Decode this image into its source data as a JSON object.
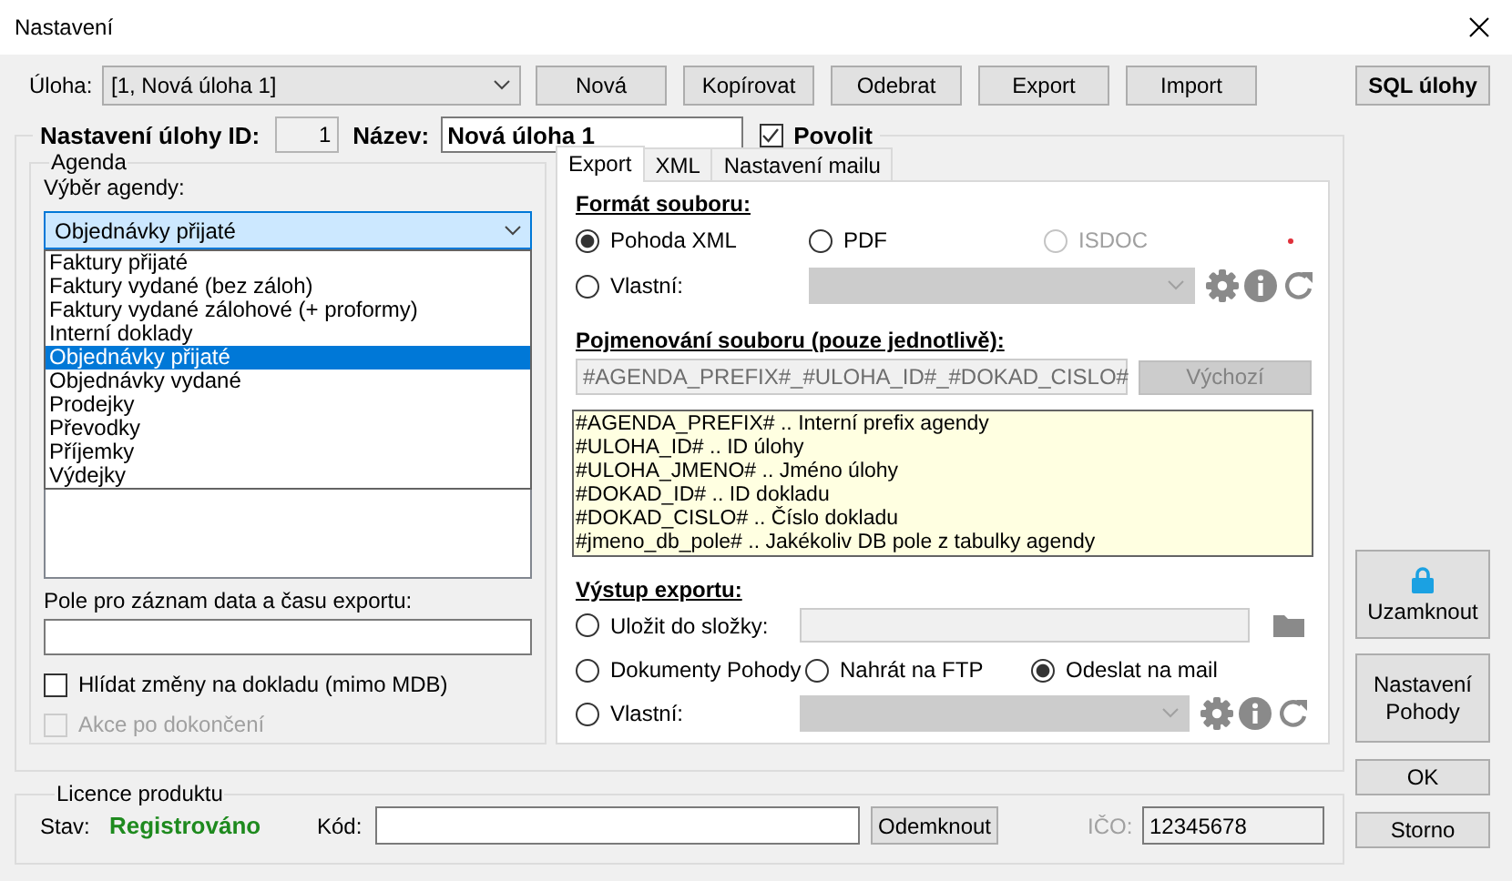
{
  "window": {
    "title": "Nastavení"
  },
  "task_bar": {
    "label": "Úloha:",
    "task_select": "[1, Nová úloha 1]",
    "buttons": [
      "Nová",
      "Kopírovat",
      "Odebrat",
      "Export",
      "Import"
    ],
    "sql_button": "SQL úlohy"
  },
  "task_settings": {
    "id_label": "Nastavení úlohy ID:",
    "id_value": "1",
    "name_label": "Název:",
    "name_value": "Nová úloha 1",
    "enable": {
      "label": "Povolit",
      "checked": true
    }
  },
  "agenda": {
    "title": "Agenda",
    "select_label": "Výběr agendy:",
    "select_value": "Objednávky přijaté",
    "expanded": true,
    "options": [
      {
        "label": "Faktury přijaté",
        "selected": false
      },
      {
        "label": "Faktury vydané (bez záloh)",
        "selected": false
      },
      {
        "label": "Faktury vydané zálohové (+ proformy)",
        "selected": false
      },
      {
        "label": "Interní doklady",
        "selected": false
      },
      {
        "label": "Objednávky přijaté",
        "selected": true
      },
      {
        "label": "Objednávky vydané",
        "selected": false
      },
      {
        "label": "Prodejky",
        "selected": false
      },
      {
        "label": "Převodky",
        "selected": false
      },
      {
        "label": "Příjemky",
        "selected": false
      },
      {
        "label": "Výdejky",
        "selected": false
      }
    ],
    "date_field_label": "Pole pro záznam data a času exportu:",
    "checkboxes": [
      {
        "label": "Hlídat změny na dokladu (mimo MDB)",
        "checked": false,
        "disabled": false
      },
      {
        "label": "Akce po dokončení",
        "checked": false,
        "disabled": true
      }
    ]
  },
  "tabs": [
    {
      "label": "Export",
      "selected": true
    },
    {
      "label": "XML",
      "selected": false
    },
    {
      "label": "Nastavení mailu",
      "selected": false
    }
  ],
  "export": {
    "format_title": "Formát souboru:",
    "formats": [
      {
        "label": "Pohoda XML",
        "selected": true,
        "disabled": false
      },
      {
        "label": "PDF",
        "selected": false,
        "disabled": false
      },
      {
        "label": "ISDOC",
        "selected": false,
        "disabled": true
      }
    ],
    "custom_format": {
      "label": "Vlastní:",
      "selected": false
    },
    "naming_title": "Pojmenování souboru (pouze jednotlivě):",
    "naming_pattern": "#AGENDA_PREFIX#_#ULOHA_ID#_#DOKAD_CISLO#",
    "default_button": "Výchozí",
    "help_lines": [
      "#AGENDA_PREFIX# .. Interní prefix agendy",
      "#ULOHA_ID# .. ID úlohy",
      "#ULOHA_JMENO# .. Jméno úlohy",
      "#DOKAD_ID# .. ID dokladu",
      "#DOKAD_CISLO# .. Číslo dokladu",
      "#jmeno_db_pole# .. Jakékoliv DB pole z tabulky agendy"
    ],
    "output_title": "Výstup exportu:",
    "outputs": [
      {
        "kind": "folder",
        "label": "Uložit do složky:",
        "selected": false
      },
      {
        "kind": "plain",
        "label": "Dokumenty Pohody",
        "selected": false
      },
      {
        "kind": "plain",
        "label": "Nahrát na FTP",
        "selected": false
      },
      {
        "kind": "plain",
        "label": "Odeslat na mail",
        "selected": true
      },
      {
        "kind": "custom",
        "label": "Vlastní:",
        "selected": false
      }
    ]
  },
  "licence": {
    "title": "Licence produktu",
    "status_label": "Stav:",
    "status": "Registrováno",
    "code_label": "Kód:",
    "unlock_button": "Odemknout",
    "ico_label": "IČO:",
    "ico_value": "12345678"
  },
  "side_buttons": [
    {
      "kind": "lock",
      "label": "Uzamknout"
    },
    {
      "kind": "big",
      "label": "Nastavení Pohody"
    },
    {
      "kind": "small",
      "label": "OK"
    },
    {
      "kind": "small",
      "label": "Storno"
    }
  ]
}
